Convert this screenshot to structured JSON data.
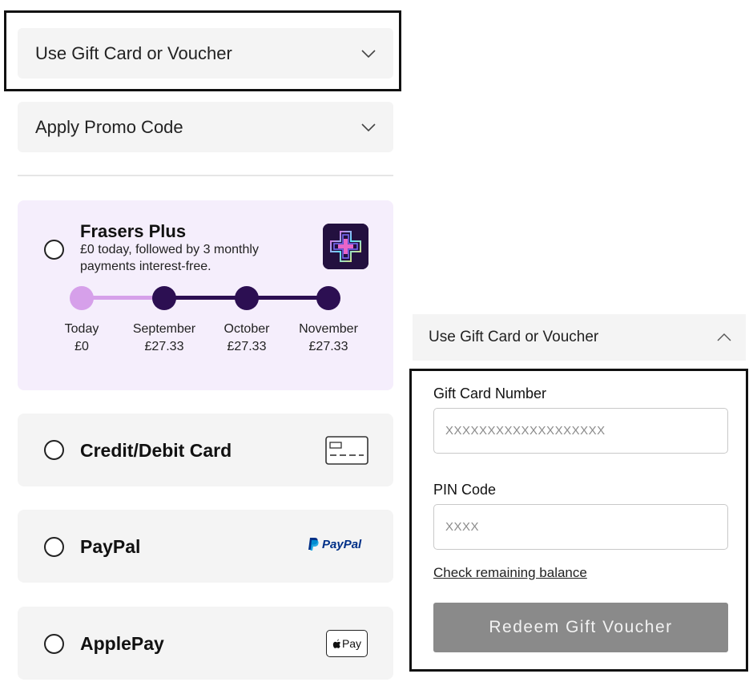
{
  "left": {
    "gift_accordion": {
      "label": "Use Gift Card or Voucher",
      "state": "collapsed"
    },
    "promo_accordion": {
      "label": "Apply Promo Code",
      "state": "collapsed"
    },
    "frasers_plus": {
      "title": "Frasers Plus",
      "subtitle": "£0 today, followed by 3 monthly payments interest-free.",
      "timeline": [
        {
          "label": "Today",
          "amount": "£0"
        },
        {
          "label": "September",
          "amount": "£27.33"
        },
        {
          "label": "October",
          "amount": "£27.33"
        },
        {
          "label": "November",
          "amount": "£27.33"
        }
      ],
      "logo_icon": "frasers-plus-logo-icon"
    },
    "payment_options": [
      {
        "label": "Credit/Debit Card",
        "icon": "credit-card-icon"
      },
      {
        "label": "PayPal",
        "icon": "paypal-logo-icon",
        "icon_text": "PayPal"
      },
      {
        "label": "ApplePay",
        "icon": "apple-pay-icon",
        "icon_text": "Pay"
      }
    ]
  },
  "right": {
    "gift_accordion": {
      "label": "Use Gift Card or Voucher",
      "state": "expanded"
    },
    "gift_card_number": {
      "label": "Gift Card Number",
      "placeholder": "XXXXXXXXXXXXXXXXXXX"
    },
    "pin_code": {
      "label": "PIN Code",
      "placeholder": "XXXX"
    },
    "check_balance_link": "Check remaining balance",
    "redeem_button": "Redeem Gift Voucher"
  },
  "colors": {
    "timeline_active": "#d6a0ea",
    "timeline_inactive": "#2c0f52",
    "frasers_bg": "#f5eefc",
    "button_disabled": "#8a8a8a",
    "paypal_dark": "#003087",
    "paypal_light": "#009cde"
  }
}
